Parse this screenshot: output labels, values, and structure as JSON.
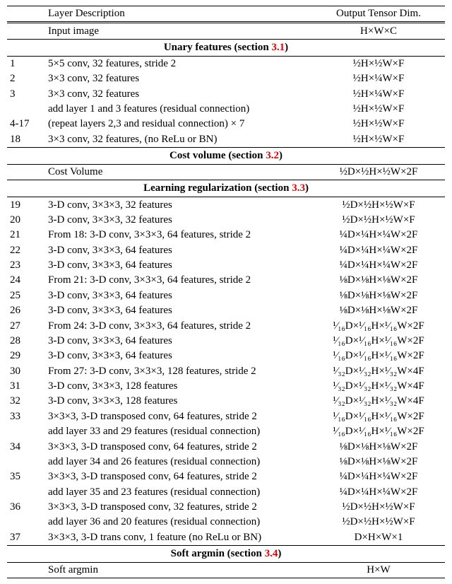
{
  "headers": {
    "col1": "",
    "col2": "Layer Description",
    "col3": "Output Tensor Dim."
  },
  "input_row": {
    "num": "",
    "desc": "Input image",
    "dim": "H×W×C"
  },
  "sections": {
    "unary": {
      "title_prefix": "Unary features (section ",
      "ref": "3.1",
      "title_suffix": ")"
    },
    "cost": {
      "title_prefix": "Cost volume (section ",
      "ref": "3.2",
      "title_suffix": ")"
    },
    "reg": {
      "title_prefix": "Learning regularization (section ",
      "ref": "3.3",
      "title_suffix": ")"
    },
    "argmin": {
      "title_prefix": "Soft argmin (section ",
      "ref": "3.4",
      "title_suffix": ")"
    }
  },
  "unary_rows": [
    {
      "num": "1",
      "desc": "5×5 conv, 32 features, stride 2",
      "dim": "½H×½W×F"
    },
    {
      "num": "2",
      "desc": "3×3 conv, 32 features",
      "dim": "½H×¼W×F"
    },
    {
      "num": "3",
      "desc": "3×3 conv, 32 features",
      "dim": "½H×¼W×F"
    },
    {
      "num": "",
      "desc": "add layer 1 and 3 features (residual connection)",
      "dim": "½H×½W×F"
    },
    {
      "num": "4-17",
      "desc": "(repeat layers 2,3 and residual connection) × 7",
      "dim": "½H×½W×F"
    },
    {
      "num": "18",
      "desc": "3×3 conv, 32 features, (no ReLu or BN)",
      "dim": "½H×½W×F"
    }
  ],
  "cost_rows": [
    {
      "num": "",
      "desc": "Cost Volume",
      "dim": "½D×½H×½W×2F"
    }
  ],
  "reg_rows": [
    {
      "num": "19",
      "desc": "3-D conv, 3×3×3, 32 features",
      "dim": "½D×½H×½W×F"
    },
    {
      "num": "20",
      "desc": "3-D conv, 3×3×3, 32 features",
      "dim": "½D×½H×½W×F"
    },
    {
      "num": "21",
      "desc": "From 18: 3-D conv, 3×3×3, 64 features, stride 2",
      "dim": "¼D×¼H×¼W×2F"
    },
    {
      "num": "22",
      "desc": "3-D conv, 3×3×3, 64 features",
      "dim": "¼D×¼H×¼W×2F"
    },
    {
      "num": "23",
      "desc": "3-D conv, 3×3×3, 64 features",
      "dim": "¼D×¼H×¼W×2F"
    },
    {
      "num": "24",
      "desc": "From 21: 3-D conv, 3×3×3, 64 features, stride 2",
      "dim": "⅛D×⅛H×⅛W×2F"
    },
    {
      "num": "25",
      "desc": "3-D conv, 3×3×3, 64 features",
      "dim": "⅛D×⅛H×⅛W×2F"
    },
    {
      "num": "26",
      "desc": "3-D conv, 3×3×3, 64 features",
      "dim": "⅛D×⅛H×⅛W×2F"
    },
    {
      "num": "27",
      "desc": "From 24: 3-D conv, 3×3×3, 64 features, stride 2",
      "dim": "¹⁄₁₆D×¹⁄₁₆H×¹⁄₁₆W×2F"
    },
    {
      "num": "28",
      "desc": "3-D conv, 3×3×3, 64 features",
      "dim": "¹⁄₁₆D×¹⁄₁₆H×¹⁄₁₆W×2F"
    },
    {
      "num": "29",
      "desc": "3-D conv, 3×3×3, 64 features",
      "dim": "¹⁄₁₆D×¹⁄₁₆H×¹⁄₁₆W×2F"
    },
    {
      "num": "30",
      "desc": "From 27: 3-D conv, 3×3×3, 128 features, stride 2",
      "dim": "¹⁄₃₂D×¹⁄₃₂H×¹⁄₃₂W×4F"
    },
    {
      "num": "31",
      "desc": "3-D conv, 3×3×3, 128 features",
      "dim": "¹⁄₃₂D×¹⁄₃₂H×¹⁄₃₂W×4F"
    },
    {
      "num": "32",
      "desc": "3-D conv, 3×3×3, 128 features",
      "dim": "¹⁄₃₂D×¹⁄₃₂H×¹⁄₃₂W×4F"
    },
    {
      "num": "33",
      "desc": "3×3×3, 3-D transposed conv, 64 features, stride 2",
      "dim": "¹⁄₁₆D×¹⁄₁₆H×¹⁄₁₆W×2F"
    },
    {
      "num": "",
      "desc": "add layer 33 and 29 features (residual connection)",
      "dim": "¹⁄₁₆D×¹⁄₁₆H×¹⁄₁₆W×2F"
    },
    {
      "num": "34",
      "desc": "3×3×3, 3-D transposed conv, 64 features, stride 2",
      "dim": "⅛D×⅛H×⅛W×2F"
    },
    {
      "num": "",
      "desc": "add layer 34 and 26 features (residual connection)",
      "dim": "⅛D×⅛H×⅛W×2F"
    },
    {
      "num": "35",
      "desc": "3×3×3, 3-D transposed conv, 64 features, stride 2",
      "dim": "¼D×¼H×¼W×2F"
    },
    {
      "num": "",
      "desc": "add layer 35 and 23 features (residual connection)",
      "dim": "¼D×¼H×¼W×2F"
    },
    {
      "num": "36",
      "desc": "3×3×3, 3-D transposed conv, 32 features, stride 2",
      "dim": "½D×½H×½W×F"
    },
    {
      "num": "",
      "desc": "add layer 36 and 20 features (residual connection)",
      "dim": "½D×½H×½W×F"
    },
    {
      "num": "37",
      "desc": "3×3×3, 3-D trans conv, 1 feature (no ReLu or BN)",
      "dim": "D×H×W×1"
    }
  ],
  "argmin_rows": [
    {
      "num": "",
      "desc": "Soft argmin",
      "dim": "H×W"
    }
  ]
}
